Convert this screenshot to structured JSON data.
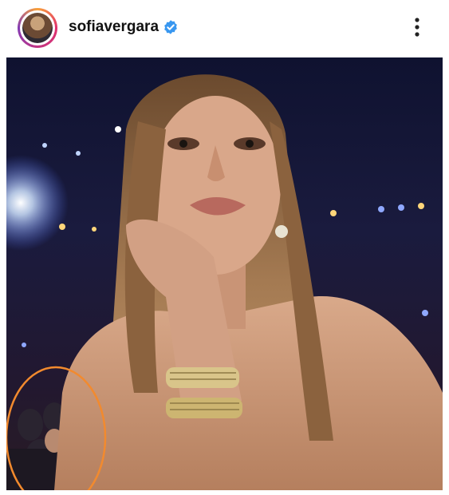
{
  "post": {
    "username": "sofiavergara",
    "verified": true,
    "avatar_icon": "profile-avatar",
    "verified_icon": "verified-badge-icon",
    "more_icon": "more-options-icon",
    "photo_description_icons": [
      "selfie-photo",
      "orange-highlight-circle"
    ],
    "colors": {
      "verified": "#3897f0",
      "highlight": "#f28a2e"
    }
  }
}
